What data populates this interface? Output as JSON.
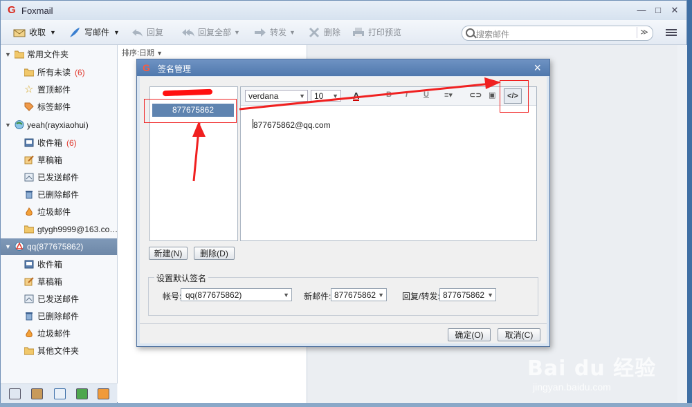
{
  "app": {
    "title": "Foxmail"
  },
  "window_controls": {
    "minimize": "—",
    "maximize": "□",
    "close": "✕"
  },
  "toolbar": {
    "receive": "收取",
    "compose": "写邮件",
    "reply": "回复",
    "reply_all": "回复全部",
    "forward": "转发",
    "delete": "删除",
    "print_preview": "打印预览",
    "search_placeholder": "搜索邮件",
    "search_dropdown": "≫"
  },
  "sidebar": {
    "groups": [
      {
        "label": "常用文件夹",
        "items": [
          {
            "label": "所有未读",
            "count": "(6)"
          },
          {
            "label": "置顶邮件",
            "count": ""
          },
          {
            "label": "标签邮件",
            "count": ""
          }
        ]
      },
      {
        "label": "yeah(rayxiaohui)",
        "items": [
          {
            "label": "收件箱",
            "count": "(6)"
          },
          {
            "label": "草稿箱",
            "count": ""
          },
          {
            "label": "已发送邮件",
            "count": ""
          },
          {
            "label": "已删除邮件",
            "count": ""
          },
          {
            "label": "垃圾邮件",
            "count": ""
          },
          {
            "label": "gtygh9999@163.co…",
            "count": ""
          }
        ]
      },
      {
        "label": "qq(877675862)",
        "items": [
          {
            "label": "收件箱",
            "count": ""
          },
          {
            "label": "草稿箱",
            "count": ""
          },
          {
            "label": "已发送邮件",
            "count": ""
          },
          {
            "label": "已删除邮件",
            "count": ""
          },
          {
            "label": "垃圾邮件",
            "count": ""
          },
          {
            "label": "其他文件夹",
            "count": ""
          }
        ]
      }
    ]
  },
  "mail_list": {
    "sort_label": "排序:日期"
  },
  "dialog": {
    "title": "签名管理",
    "selected_signature": "877675862",
    "editor": {
      "font": "verdana",
      "size": "10",
      "bold": "B",
      "italic": "I",
      "underline": "U",
      "code_button": "</>",
      "content": "877675862@qq.com"
    },
    "new_button": "新建(N)",
    "delete_button": "删除(D)",
    "default_group": {
      "legend": "设置默认签名",
      "account_label": "帐号:",
      "account_value": "qq(877675862)",
      "new_mail_label": "新邮件:",
      "new_mail_value": "877675862",
      "reply_label": "回复/转发:",
      "reply_value": "877675862"
    },
    "ok_button": "确定(O)",
    "cancel_button": "取消(C)"
  },
  "watermark": {
    "brand": "Bai du 经验",
    "url": "jingyan.baidu.com"
  }
}
